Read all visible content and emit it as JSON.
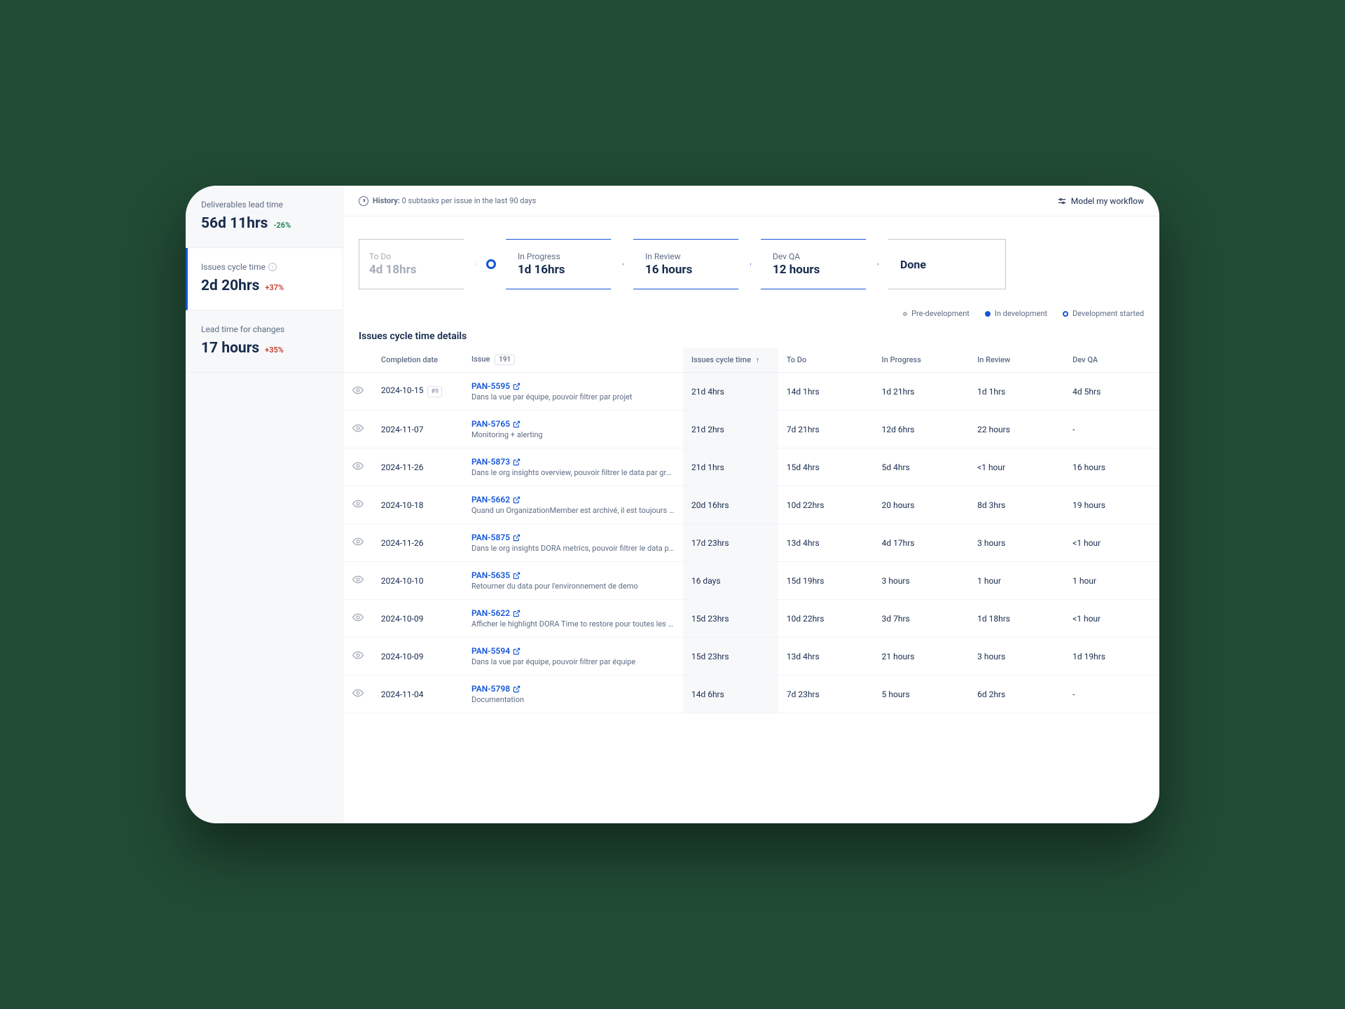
{
  "sidebar": {
    "metrics": [
      {
        "label": "Deliverables lead time",
        "value": "56d 11hrs",
        "delta": "-26%",
        "delta_class": "delta-neg",
        "info": false
      },
      {
        "label": "Issues cycle time",
        "value": "2d 20hrs",
        "delta": "+37%",
        "delta_class": "delta-pos",
        "info": true
      },
      {
        "label": "Lead time for changes",
        "value": "17 hours",
        "delta": "+35%",
        "delta_class": "delta-pos",
        "info": false
      }
    ]
  },
  "topbar": {
    "history_prefix": "History:",
    "history_text": "0 subtasks per issue in the last 90 days",
    "model_btn": "Model my workflow"
  },
  "workflow": {
    "stages": [
      {
        "label": "To Do",
        "value": "4d 18hrs",
        "muted": true,
        "first": true
      },
      {
        "label": "In Progress",
        "value": "1d 16hrs",
        "active": true
      },
      {
        "label": "In Review",
        "value": "16 hours",
        "active": true
      },
      {
        "label": "Dev QA",
        "value": "12 hours",
        "active": true
      },
      {
        "label": "",
        "value": "Done",
        "done": true,
        "last": true
      }
    ]
  },
  "legend": {
    "pre": "Pre-development",
    "indev": "In development",
    "started": "Development started"
  },
  "table": {
    "title": "Issues cycle time details",
    "issue_count": "191",
    "columns": {
      "completion": "Completion date",
      "issue": "Issue",
      "cycle": "Issues cycle time",
      "todo": "To Do",
      "inprogress": "In Progress",
      "inreview": "In Review",
      "devqa": "Dev QA"
    },
    "rows": [
      {
        "date": "2024-10-15",
        "badge": "#9",
        "key": "PAN-5595",
        "desc": "Dans la vue par équipe, pouvoir filtrer par projet",
        "cycle": "21d 4hrs",
        "todo": "14d 1hrs",
        "inprogress": "1d 21hrs",
        "inreview": "1d 1hrs",
        "devqa": "4d 5hrs"
      },
      {
        "date": "2024-11-07",
        "key": "PAN-5765",
        "desc": "Monitoring + alerting",
        "cycle": "21d 2hrs",
        "todo": "7d 21hrs",
        "inprogress": "12d 6hrs",
        "inreview": "22 hours",
        "devqa": "-"
      },
      {
        "date": "2024-11-26",
        "key": "PAN-5873",
        "desc": "Dans le org insights overview, pouvoir filtrer le data par group…",
        "cycle": "21d 1hrs",
        "todo": "15d 4hrs",
        "inprogress": "5d 4hrs",
        "inreview": "<1 hour",
        "devqa": "16 hours"
      },
      {
        "date": "2024-10-18",
        "key": "PAN-5662",
        "desc": "Quand un OrganizationMember est archivé, il est toujours con…",
        "cycle": "20d 16hrs",
        "todo": "10d 22hrs",
        "inprogress": "20 hours",
        "inreview": "8d 3hrs",
        "devqa": "19 hours"
      },
      {
        "date": "2024-11-26",
        "key": "PAN-5875",
        "desc": "Dans le org insights DORA metrics, pouvoir filtrer le data par g…",
        "cycle": "17d 23hrs",
        "todo": "13d 4hrs",
        "inprogress": "4d 17hrs",
        "inreview": "3 hours",
        "devqa": "<1 hour"
      },
      {
        "date": "2024-10-10",
        "key": "PAN-5635",
        "desc": "Retourner du data pour l'environnement de demo",
        "cycle": "16 days",
        "todo": "15d 19hrs",
        "inprogress": "3 hours",
        "inreview": "1 hour",
        "devqa": "1 hour"
      },
      {
        "date": "2024-10-09",
        "key": "PAN-5622",
        "desc": "Afficher le highlight DORA Time to restore pour toutes les équ…",
        "cycle": "15d 23hrs",
        "todo": "10d 22hrs",
        "inprogress": "3d 7hrs",
        "inreview": "1d 18hrs",
        "devqa": "<1 hour"
      },
      {
        "date": "2024-10-09",
        "key": "PAN-5594",
        "desc": "Dans la vue par équipe, pouvoir filtrer par équipe",
        "cycle": "15d 23hrs",
        "todo": "13d 4hrs",
        "inprogress": "21 hours",
        "inreview": "3 hours",
        "devqa": "1d 19hrs"
      },
      {
        "date": "2024-11-04",
        "key": "PAN-5798",
        "desc": "Documentation",
        "cycle": "14d 6hrs",
        "todo": "7d 23hrs",
        "inprogress": "5 hours",
        "inreview": "6d 2hrs",
        "devqa": "-"
      }
    ]
  }
}
